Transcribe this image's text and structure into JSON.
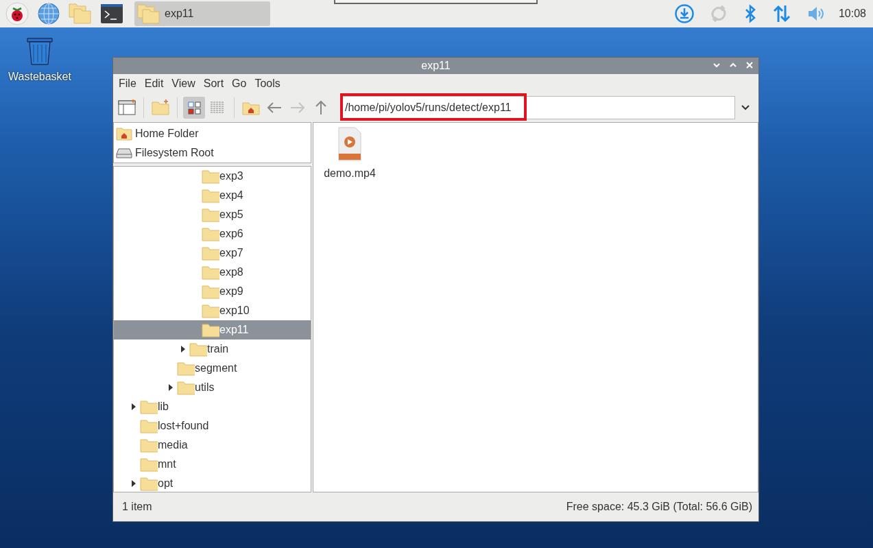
{
  "taskbar": {
    "launchers": [
      {
        "kind": "menu"
      },
      {
        "kind": "browser"
      },
      {
        "kind": "files"
      },
      {
        "kind": "terminal"
      }
    ],
    "tasks": [
      {
        "label": "exp11",
        "selected": true
      }
    ],
    "tray": [
      {
        "kind": "download",
        "disabled": false
      },
      {
        "kind": "sync",
        "disabled": true
      },
      {
        "kind": "bluetooth",
        "disabled": false
      },
      {
        "kind": "network",
        "disabled": false
      },
      {
        "kind": "volume",
        "disabled": false
      }
    ],
    "clock": "10:08"
  },
  "desktop_icons": [
    {
      "label": "Wastebasket"
    }
  ],
  "window": {
    "title": "exp11",
    "menu": [
      "File",
      "Edit",
      "View",
      "Sort",
      "Go",
      "Tools"
    ],
    "toolbar": [
      {
        "kind": "sidebar",
        "selected": false,
        "disabled": false
      },
      {
        "kind": "sep"
      },
      {
        "kind": "newfolder",
        "selected": false,
        "disabled": false
      },
      {
        "kind": "sep"
      },
      {
        "kind": "iconview",
        "selected": true,
        "disabled": false
      },
      {
        "kind": "listview",
        "selected": false,
        "disabled": false
      },
      {
        "kind": "sep"
      },
      {
        "kind": "home",
        "selected": false,
        "disabled": false
      },
      {
        "kind": "back",
        "selected": false,
        "disabled": false
      },
      {
        "kind": "forward",
        "selected": false,
        "disabled": true
      },
      {
        "kind": "up",
        "selected": false,
        "disabled": false
      }
    ],
    "address_bar": {
      "value": "/home/pi/yolov5/runs/detect/exp11",
      "highlighted": true
    },
    "places": [
      {
        "kind": "home",
        "label": "Home Folder"
      },
      {
        "kind": "drive",
        "label": "Filesystem Root"
      }
    ],
    "tree": [
      {
        "children": [
          {
            "children": [
              {
                "children": [
                  {
                    "children": [
                      {
                        "children": [
                          {
                            "label": "exp3",
                            "selected": false
                          },
                          {
                            "label": "exp4",
                            "selected": false
                          },
                          {
                            "label": "exp5",
                            "selected": false
                          },
                          {
                            "label": "exp6",
                            "selected": false
                          },
                          {
                            "label": "exp7",
                            "selected": false
                          },
                          {
                            "label": "exp8",
                            "selected": false
                          },
                          {
                            "label": "exp9",
                            "selected": false
                          },
                          {
                            "label": "exp10",
                            "selected": false
                          },
                          {
                            "label": "exp11",
                            "selected": true
                          }
                        ]
                      },
                      {
                        "label": "train",
                        "selected": false,
                        "expanded": false
                      }
                    ]
                  },
                  {
                    "label": "segment",
                    "selected": false
                  },
                  {
                    "label": "utils",
                    "selected": false,
                    "expanded": false
                  }
                ]
              }
            ]
          }
        ]
      },
      {
        "label": "lib",
        "selected": false,
        "expanded": false
      },
      {
        "label": "lost+found",
        "selected": false
      },
      {
        "label": "media",
        "selected": false
      },
      {
        "label": "mnt",
        "selected": false
      },
      {
        "label": "opt",
        "selected": false,
        "expanded": false
      }
    ],
    "files": [
      {
        "kind": "video",
        "label": "demo.mp4",
        "selected": false
      }
    ],
    "status_bar": {
      "left": "1 item",
      "right": "Free space: 45.3 GiB (Total: 56.6 GiB)"
    }
  }
}
